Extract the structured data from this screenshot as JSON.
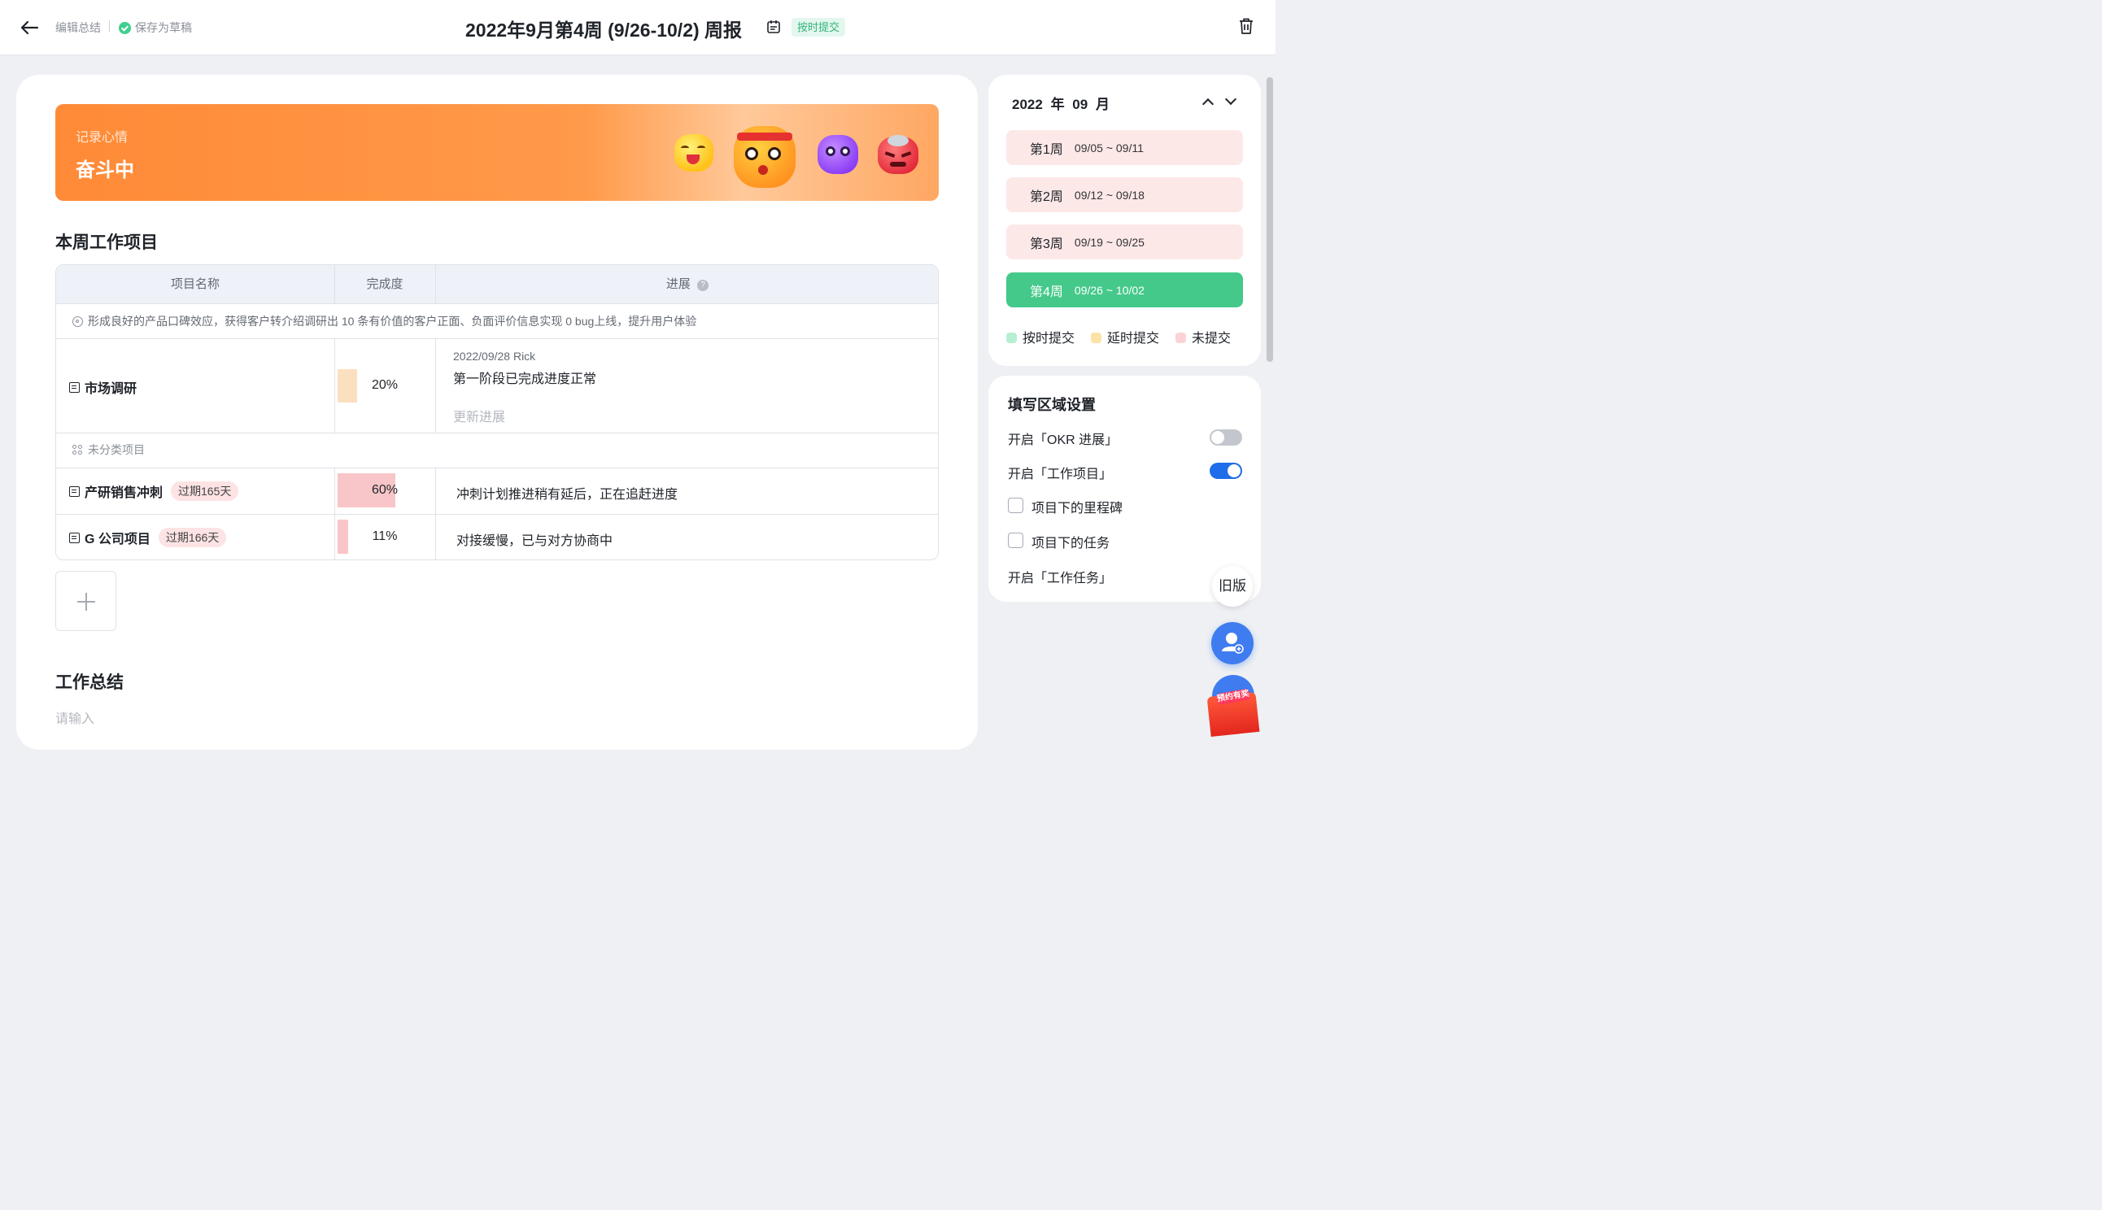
{
  "header": {
    "back_icon": "arrow-left-icon",
    "edit_label": "编辑总结",
    "saved_label": "保存为草稿",
    "title": "2022年9月第4周 (9/26-10/2) 周报",
    "status_badge": "按时提交",
    "delete_icon": "trash-icon"
  },
  "mood": {
    "label": "记录心情",
    "value": "奋斗中",
    "emojis": [
      "happy-emoji-icon",
      "fighting-emoji-icon",
      "calm-emoji-icon",
      "angry-emoji-icon"
    ]
  },
  "work_items": {
    "heading": "本周工作项目",
    "columns": [
      "项目名称",
      "完成度",
      "进展"
    ],
    "okr_text": "形成良好的产品口碑效应，获得客户转介绍调研出 10 条有价值的客户正面、负面评价信息实现 0 bug上线，提升用户体验",
    "group_label": "未分类项目",
    "rows": [
      {
        "name": "市场调研",
        "overdue": "",
        "percent": "20%",
        "progress_meta": "2022/09/28 Rick",
        "progress": "第一阶段已完成进度正常",
        "update_link": "更新进展"
      },
      {
        "name": "产研销售冲刺",
        "overdue": "过期165天",
        "percent": "60%",
        "progress": "冲刺计划推进稍有延后，正在追赶进度"
      },
      {
        "name": "G 公司项目",
        "overdue": "过期166天",
        "percent": "11%",
        "progress": "对接缓慢，已与对方协商中"
      }
    ],
    "percent_values": [
      0.2,
      0.6,
      0.11
    ],
    "bar_colors": [
      "#fbe0c0",
      "#f8c6c8",
      "#f8c6c8"
    ]
  },
  "summary": {
    "heading": "工作总结",
    "placeholder": "请输入"
  },
  "calendar": {
    "year": "2022",
    "year_unit": "年",
    "month": "09",
    "month_unit": "月",
    "weeks": [
      {
        "label": "第1周",
        "range": "09/05 ~ 09/11"
      },
      {
        "label": "第2周",
        "range": "09/12 ~ 09/18"
      },
      {
        "label": "第3周",
        "range": "09/19 ~ 09/25"
      },
      {
        "label": "第4周",
        "range": "09/26 ~ 10/02"
      }
    ],
    "active_week": 3,
    "legend": [
      {
        "label": "按时提交",
        "color": "#b6f0d4"
      },
      {
        "label": "延时提交",
        "color": "#fde1a5"
      },
      {
        "label": "未提交",
        "color": "#fcd3d5"
      }
    ]
  },
  "settings": {
    "title": "填写区域设置",
    "okr_toggle": "开启「OKR 进展」",
    "okr_on": false,
    "work_items_toggle": "开启「工作项目」",
    "work_items_on": true,
    "milestone_check": "项目下的里程碑",
    "task_check": "项目下的任务",
    "work_tasks_toggle": "开启「工作任务」"
  },
  "floating": {
    "old_version": "旧版",
    "promo": "预约有奖"
  },
  "colors": {
    "accent_green": "#45c98a",
    "mood_orange": "#ff8a37",
    "toggle_blue": "#1f6de8"
  }
}
